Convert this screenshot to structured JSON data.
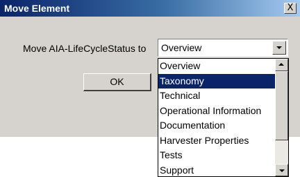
{
  "window": {
    "title": "Move Element",
    "close_glyph": "X"
  },
  "form": {
    "label": "Move AIA-LifeCycleStatus to",
    "selected_value": "Overview",
    "ok_label": "OK"
  },
  "dropdown": {
    "selected_index": 1,
    "options": [
      "Overview",
      "Taxonomy",
      "Technical",
      "Operational Information",
      "Documentation",
      "Harvester Properties",
      "Tests",
      "Support"
    ]
  },
  "colors": {
    "selection": "#0a246a",
    "dialog_face": "#d6d3ce"
  }
}
